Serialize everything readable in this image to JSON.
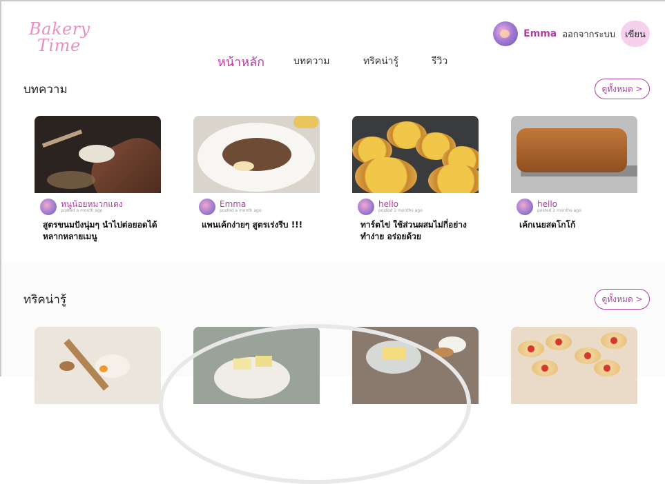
{
  "brand": {
    "line1": "Bakery",
    "line2": "Time"
  },
  "header": {
    "user_name": "Emma",
    "logout_label": "ออกจากระบบ",
    "write_label": "เขียน"
  },
  "nav": {
    "home": "หน้าหลัก",
    "articles": "บทความ",
    "tips": "ทริคน่ารู้",
    "reviews": "รีวิว"
  },
  "articles_section": {
    "title": "บทความ",
    "see_all": "ดูทั้งหมด >",
    "cards": [
      {
        "author": "หนูน้อยหมวกแดง",
        "posted": "posted a month ago",
        "title": "สูตรขนมปังนุ่มๆ นำไปต่อยอดได้หลากหลายเมนู"
      },
      {
        "author": "Emma",
        "posted": "posted a month ago",
        "title": "แพนเค้กง่ายๆ สูตรเร่งรีบ !!!"
      },
      {
        "author": "hello",
        "posted": "posted 2 months ago",
        "title": "ทาร์ตไข่ ใช้ส่วนผสมไม่กี่อย่าง ทำง่าย อร่อยด้วย"
      },
      {
        "author": "hello",
        "posted": "posted 2 months ago",
        "title": "เค้กเนยสดโกโก้"
      }
    ]
  },
  "tips_section": {
    "title": "ทริคน่ารู้",
    "see_all": "ดูทั้งหมด >"
  }
}
